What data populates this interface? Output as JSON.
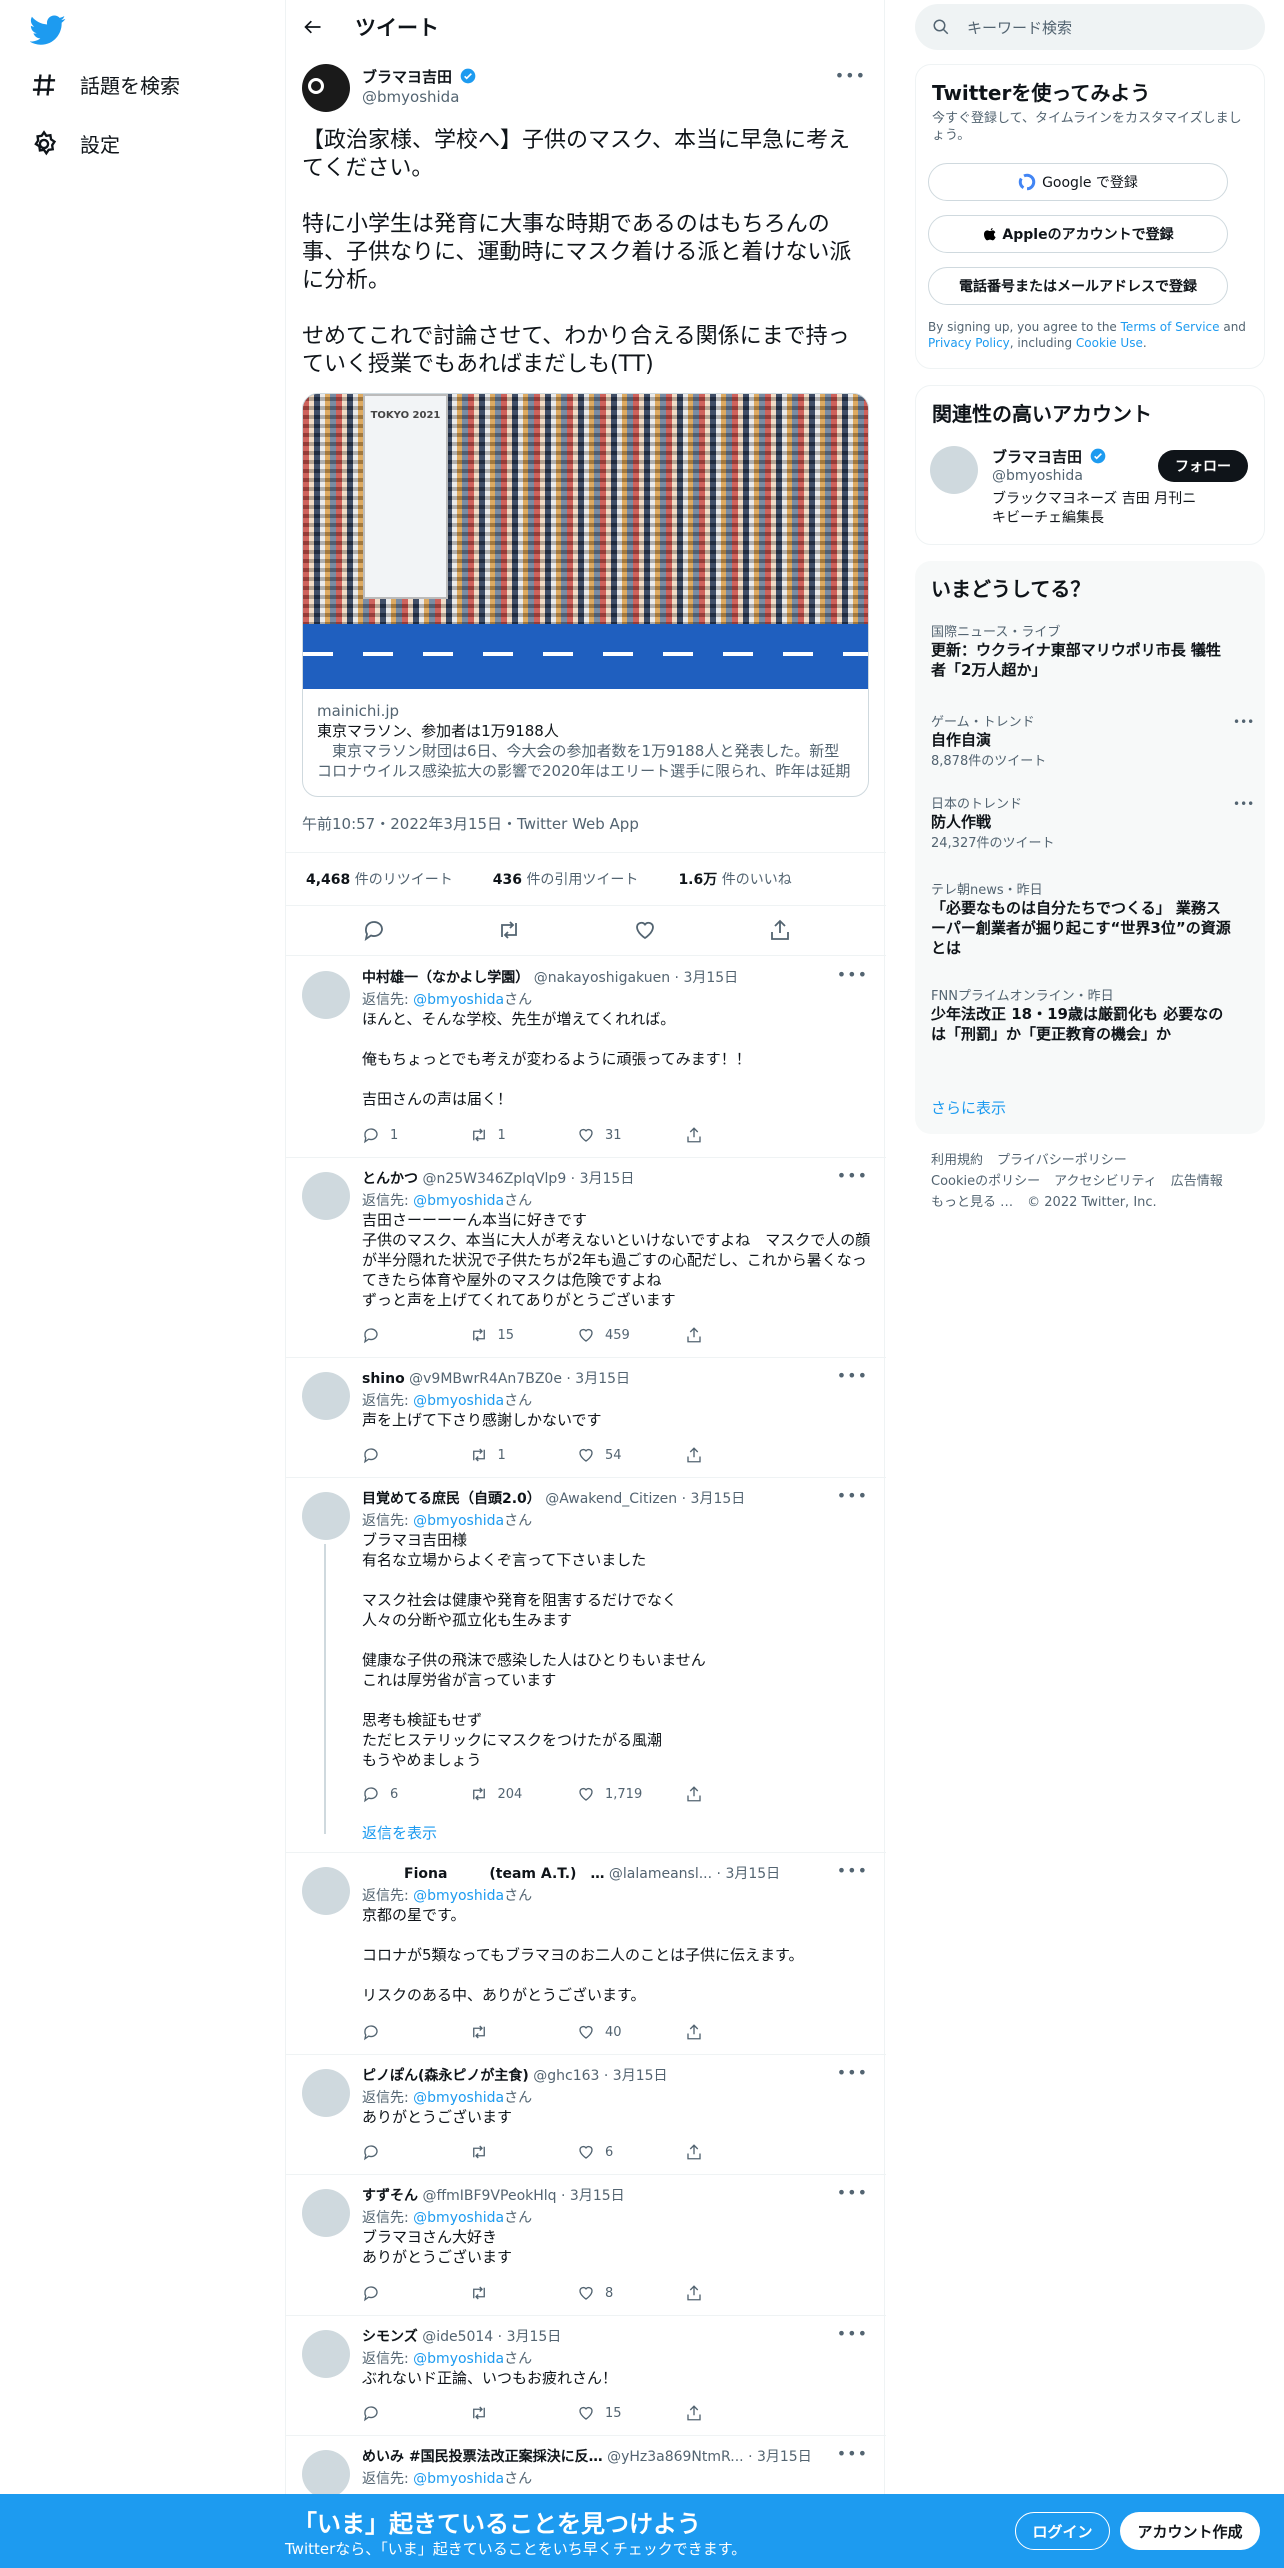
{
  "nav": {
    "explore": "話題を検索",
    "settings": "設定"
  },
  "header": {
    "title": "ツイート"
  },
  "tweet": {
    "name": "ブラマヨ吉田",
    "handle": "@bmyoshida",
    "text": "【政治家様、学校へ】子供のマスク、本当に早急に考えてください。\n\n特に小学生は発育に大事な時期であるのはもちろんの事、子供なりに、運動時にマスク着ける派と着けない派に分析。\n\nせめてこれで討論させて、わかり合える関係にまで持っていく授業でもあればまだしも(TT)",
    "card": {
      "domain": "mainichi.jp",
      "title": "東京マラソン、参加者は1万9188人",
      "desc": "　東京マラソン財団は6日、今大会の参加者数を1万9188人と発表した。新型コロナウイルス感染拡大の影響で2020年はエリート選手に限られ、昨年は延期さ…",
      "image_text": "TOKYO 2021"
    },
    "meta": "午前10:57・2022年3月15日・Twitter Web App",
    "retweets": "4,468",
    "retweets_label": "件のリツイート",
    "quotes": "436",
    "quotes_label": "件の引用ツイート",
    "likes": "1.6万",
    "likes_label": "件のいいね"
  },
  "reply_to_label": "返信先: ",
  "reply_to_handle": "@bmyoshida",
  "reply_to_suffix": "さん",
  "replies": [
    {
      "name": "中村雄一（なかよし学園）",
      "handle": "@nakayoshigakuen",
      "date": "3月15日",
      "text": "ほんと、そんな学校、先生が増えてくれれば。\n\n俺もちょっとでも考えが変わるように頑張ってみます！！\n\n吉田さんの声は届く！",
      "reply": "1",
      "rt": "1",
      "like": "31"
    },
    {
      "name": "とんかつ",
      "handle": "@n25W346ZplqVlp9",
      "date": "3月15日",
      "text": "吉田さーーーーん本当に好きです\n子供のマスク、本当に大人が考えないといけないですよね　マスクで人の顔が半分隠れた状況で子供たちが2年も過ごすの心配だし、これから暑くなってきたら体育や屋外のマスクは危険ですよね\nずっと声を上げてくれてありがとうございます",
      "reply": "",
      "rt": "15",
      "like": "459"
    },
    {
      "name": "shino",
      "handle": "@v9MBwrR4An7BZ0e",
      "date": "3月15日",
      "text": "声を上げて下さり感謝しかないです",
      "reply": "",
      "rt": "1",
      "like": "54"
    },
    {
      "name": "目覚めてる庶民（自頭2.0）",
      "handle": "@Awakend_Citizen",
      "date": "3月15日",
      "text": "ブラマヨ吉田様\n有名な立場からよくぞ言って下さいました\n\nマスク社会は健康や発育を阻害するだけでなく\n人々の分断や孤立化も生みます\n\n健康な子供の飛沫で感染した人はひとりもいません\nこれは厚労省が言っています\n\n思考も検証もせず\nただヒステリックにマスクをつけたがる風潮\nもうやめましょう",
      "reply": "6",
      "rt": "204",
      "like": "1,719",
      "show": "返信を表示"
    },
    {
      "name": "　　　Fiona　　　(team A.T.)　…",
      "handle": "@lalameansl...",
      "date": "3月15日",
      "text": "京都の星です。\n\nコロナが5類なってもブラマヨのお二人のことは子供に伝えます。\n\nリスクのある中、ありがとうございます。",
      "reply": "",
      "rt": "",
      "like": "40"
    },
    {
      "name": "ピノぽん(森永ピノが主食)",
      "handle": "@ghc163",
      "date": "3月15日",
      "text": "ありがとうございます",
      "reply": "",
      "rt": "",
      "like": "6"
    },
    {
      "name": "すずそん",
      "handle": "@ffmIBF9VPeokHlq",
      "date": "3月15日",
      "text": "ブラマヨさん大好き\nありがとうございます",
      "reply": "",
      "rt": "",
      "like": "8"
    },
    {
      "name": "シモンズ",
      "handle": "@ide5014",
      "date": "3月15日",
      "text": "ぶれないド正論、いつもお疲れさん！",
      "reply": "",
      "rt": "",
      "like": "15"
    },
    {
      "name": "めいみ #国民投票法改正案採決に反…",
      "handle": "@yHz3a869NtmR...",
      "date": "3月15日",
      "text": "",
      "reply": "",
      "rt": "",
      "like": ""
    }
  ],
  "right": {
    "search_placeholder": "キーワード検索",
    "signup": {
      "title": "Twitterを使ってみよう",
      "subtitle": "今すぐ登録して、タイムラインをカスタマイズしましょう。",
      "google": "Google で登録",
      "apple": "Appleのアカウントで登録",
      "phone": "電話番号またはメールアドレスで登録",
      "terms_pre": "By signing up, you agree to the ",
      "terms": "Terms of Service",
      "and": " and ",
      "privacy": "Privacy Policy",
      "including": ", including ",
      "cookie": "Cookie Use",
      "dot": "."
    },
    "related": {
      "title": "関連性の高いアカウント",
      "name": "ブラマヨ吉田",
      "handle": "@bmyoshida",
      "bio": "ブラックマヨネーズ 吉田 月刊ニキビーチェ編集長",
      "follow": "フォロー"
    },
    "trends": {
      "title": "いまどうしてる？",
      "items": [
        {
          "c": "国際ニュース・ライブ",
          "h": "更新：ウクライナ東部マリウポリ市長 犠牲者「2万人超か」",
          "s": ""
        },
        {
          "c": "ゲーム・トレンド",
          "h": "自作自演",
          "s": "8,878件のツイート"
        },
        {
          "c": "日本のトレンド",
          "h": "防人作戦",
          "s": "24,327件のツイート"
        },
        {
          "c": "テレ朝news・昨日",
          "h": "「必要なものは自分たちでつくる」 業務スーパー創業者が掘り起こす“世界3位”の資源とは",
          "s": ""
        },
        {
          "c": "FNNプライムオンライン・昨日",
          "h": "少年法改正 18・19歳は厳罰化も 必要なのは「刑罰」か「更正教育の機会」か",
          "s": ""
        }
      ],
      "more": "さらに表示"
    },
    "footer": [
      "利用規約",
      "プライバシーポリシー",
      "Cookieのポリシー",
      "アクセシビリティ",
      "広告情報",
      "もっと見る …",
      "© 2022 Twitter, Inc."
    ]
  },
  "bottom": {
    "title": "「いま」起きていることを見つけよう",
    "subtitle": "Twitterなら、「いま」起きていることをいち早くチェックできます。",
    "login": "ログイン",
    "signup": "アカウント作成"
  },
  "colors": {
    "accent": "#1d9bf0",
    "text": "#0f1419",
    "muted": "#536471"
  }
}
